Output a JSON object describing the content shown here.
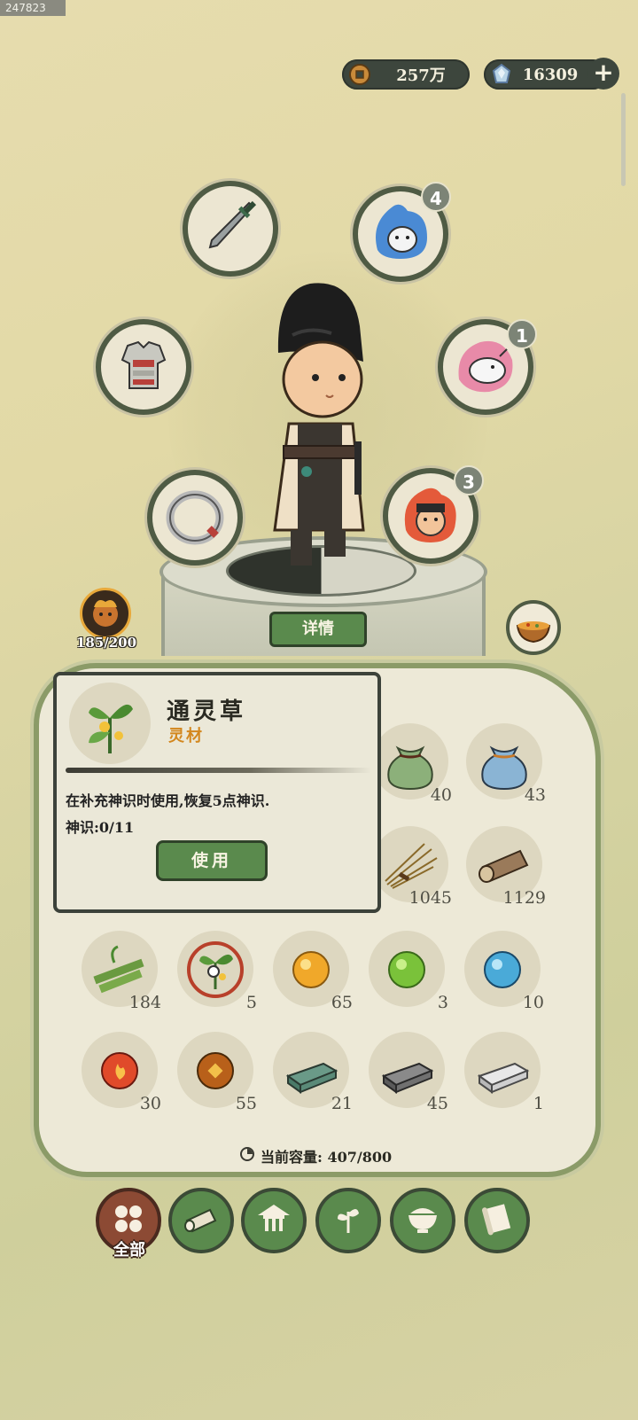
{
  "build_id": "247823",
  "currency": {
    "coins": {
      "icon": "copper-coin-icon",
      "value": "257万"
    },
    "jade": {
      "icon": "spirit-jade-icon",
      "value": "16309"
    },
    "add_label": "+"
  },
  "equipment": {
    "weapon": {
      "icon": "sword-icon"
    },
    "armor": {
      "icon": "armor-icon"
    },
    "ring": {
      "icon": "ring-icon"
    },
    "spirit_blue": {
      "icon": "blue-spirit-pet-icon",
      "badge": "4"
    },
    "spirit_pink": {
      "icon": "pink-spirit-beast-icon",
      "badge": "1"
    },
    "spirit_red": {
      "icon": "red-general-spirit-icon",
      "badge": "3"
    }
  },
  "details_label": "详情",
  "stamina": {
    "icon": "stamina-face-icon",
    "value": "185/200"
  },
  "food": {
    "icon": "food-bowl-icon"
  },
  "tooltip": {
    "name": "通灵草",
    "type": "灵材",
    "description": "在补充神识时使用,恢复5点神识.",
    "sense": "神识:0/11",
    "use_label": "使用"
  },
  "inventory": [
    {
      "id": "green-bag",
      "icon": "green-pouch-icon",
      "count": "40"
    },
    {
      "id": "blue-bag",
      "icon": "blue-pouch-icon",
      "count": "43"
    },
    {
      "id": "straw",
      "icon": "straw-icon",
      "count": "1045"
    },
    {
      "id": "log",
      "icon": "log-icon",
      "count": "1129"
    },
    {
      "id": "bamboo",
      "icon": "bamboo-icon",
      "count": "184"
    },
    {
      "id": "spirit-herb",
      "icon": "spirit-herb-icon",
      "count": "5"
    },
    {
      "id": "gold-orb",
      "icon": "gold-orb-icon",
      "count": "65"
    },
    {
      "id": "green-orb",
      "icon": "green-orb-icon",
      "count": "3"
    },
    {
      "id": "blue-orb",
      "icon": "blue-orb-icon",
      "count": "10"
    },
    {
      "id": "fire-orb",
      "icon": "fire-orb-icon",
      "count": "30"
    },
    {
      "id": "earth-orb",
      "icon": "earth-orb-icon",
      "count": "55"
    },
    {
      "id": "jade-ingot",
      "icon": "jade-ingot-icon",
      "count": "21"
    },
    {
      "id": "iron-ingot",
      "icon": "iron-ingot-icon",
      "count": "45"
    },
    {
      "id": "silver-ingot",
      "icon": "silver-ingot-icon",
      "count": "1"
    }
  ],
  "capacity": {
    "icon": "capacity-icon",
    "label": "当前容量: 407/800"
  },
  "tabs": [
    {
      "id": "all",
      "icon": "four-dots-icon",
      "label": "全部",
      "active": true
    },
    {
      "id": "materials",
      "icon": "log-icon",
      "active": false
    },
    {
      "id": "buildings",
      "icon": "pavilion-icon",
      "active": false
    },
    {
      "id": "herbs",
      "icon": "herb-icon",
      "active": false
    },
    {
      "id": "food",
      "icon": "rice-bowl-icon",
      "active": false
    },
    {
      "id": "scrolls",
      "icon": "scroll-icon",
      "active": false
    }
  ],
  "colors": {
    "accent_green": "#5a8a4d",
    "dark_panel": "#3d463d",
    "rare_orange": "#d3871e",
    "active_tab": "#8c4a34"
  }
}
